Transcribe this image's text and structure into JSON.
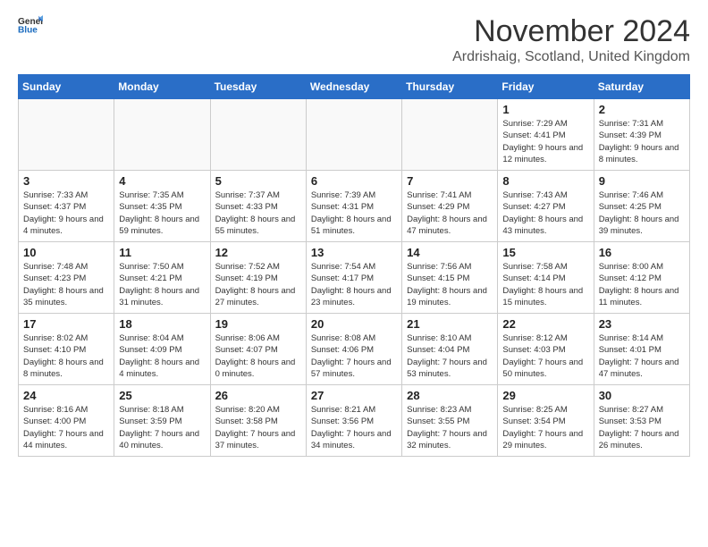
{
  "header": {
    "logo_general": "General",
    "logo_blue": "Blue",
    "month_title": "November 2024",
    "location": "Ardrishaig, Scotland, United Kingdom"
  },
  "weekdays": [
    "Sunday",
    "Monday",
    "Tuesday",
    "Wednesday",
    "Thursday",
    "Friday",
    "Saturday"
  ],
  "weeks": [
    [
      {
        "day": "",
        "info": "",
        "empty": true
      },
      {
        "day": "",
        "info": "",
        "empty": true
      },
      {
        "day": "",
        "info": "",
        "empty": true
      },
      {
        "day": "",
        "info": "",
        "empty": true
      },
      {
        "day": "",
        "info": "",
        "empty": true
      },
      {
        "day": "1",
        "info": "Sunrise: 7:29 AM\nSunset: 4:41 PM\nDaylight: 9 hours and 12 minutes."
      },
      {
        "day": "2",
        "info": "Sunrise: 7:31 AM\nSunset: 4:39 PM\nDaylight: 9 hours and 8 minutes."
      }
    ],
    [
      {
        "day": "3",
        "info": "Sunrise: 7:33 AM\nSunset: 4:37 PM\nDaylight: 9 hours and 4 minutes."
      },
      {
        "day": "4",
        "info": "Sunrise: 7:35 AM\nSunset: 4:35 PM\nDaylight: 8 hours and 59 minutes."
      },
      {
        "day": "5",
        "info": "Sunrise: 7:37 AM\nSunset: 4:33 PM\nDaylight: 8 hours and 55 minutes."
      },
      {
        "day": "6",
        "info": "Sunrise: 7:39 AM\nSunset: 4:31 PM\nDaylight: 8 hours and 51 minutes."
      },
      {
        "day": "7",
        "info": "Sunrise: 7:41 AM\nSunset: 4:29 PM\nDaylight: 8 hours and 47 minutes."
      },
      {
        "day": "8",
        "info": "Sunrise: 7:43 AM\nSunset: 4:27 PM\nDaylight: 8 hours and 43 minutes."
      },
      {
        "day": "9",
        "info": "Sunrise: 7:46 AM\nSunset: 4:25 PM\nDaylight: 8 hours and 39 minutes."
      }
    ],
    [
      {
        "day": "10",
        "info": "Sunrise: 7:48 AM\nSunset: 4:23 PM\nDaylight: 8 hours and 35 minutes."
      },
      {
        "day": "11",
        "info": "Sunrise: 7:50 AM\nSunset: 4:21 PM\nDaylight: 8 hours and 31 minutes."
      },
      {
        "day": "12",
        "info": "Sunrise: 7:52 AM\nSunset: 4:19 PM\nDaylight: 8 hours and 27 minutes."
      },
      {
        "day": "13",
        "info": "Sunrise: 7:54 AM\nSunset: 4:17 PM\nDaylight: 8 hours and 23 minutes."
      },
      {
        "day": "14",
        "info": "Sunrise: 7:56 AM\nSunset: 4:15 PM\nDaylight: 8 hours and 19 minutes."
      },
      {
        "day": "15",
        "info": "Sunrise: 7:58 AM\nSunset: 4:14 PM\nDaylight: 8 hours and 15 minutes."
      },
      {
        "day": "16",
        "info": "Sunrise: 8:00 AM\nSunset: 4:12 PM\nDaylight: 8 hours and 11 minutes."
      }
    ],
    [
      {
        "day": "17",
        "info": "Sunrise: 8:02 AM\nSunset: 4:10 PM\nDaylight: 8 hours and 8 minutes."
      },
      {
        "day": "18",
        "info": "Sunrise: 8:04 AM\nSunset: 4:09 PM\nDaylight: 8 hours and 4 minutes."
      },
      {
        "day": "19",
        "info": "Sunrise: 8:06 AM\nSunset: 4:07 PM\nDaylight: 8 hours and 0 minutes."
      },
      {
        "day": "20",
        "info": "Sunrise: 8:08 AM\nSunset: 4:06 PM\nDaylight: 7 hours and 57 minutes."
      },
      {
        "day": "21",
        "info": "Sunrise: 8:10 AM\nSunset: 4:04 PM\nDaylight: 7 hours and 53 minutes."
      },
      {
        "day": "22",
        "info": "Sunrise: 8:12 AM\nSunset: 4:03 PM\nDaylight: 7 hours and 50 minutes."
      },
      {
        "day": "23",
        "info": "Sunrise: 8:14 AM\nSunset: 4:01 PM\nDaylight: 7 hours and 47 minutes."
      }
    ],
    [
      {
        "day": "24",
        "info": "Sunrise: 8:16 AM\nSunset: 4:00 PM\nDaylight: 7 hours and 44 minutes."
      },
      {
        "day": "25",
        "info": "Sunrise: 8:18 AM\nSunset: 3:59 PM\nDaylight: 7 hours and 40 minutes."
      },
      {
        "day": "26",
        "info": "Sunrise: 8:20 AM\nSunset: 3:58 PM\nDaylight: 7 hours and 37 minutes."
      },
      {
        "day": "27",
        "info": "Sunrise: 8:21 AM\nSunset: 3:56 PM\nDaylight: 7 hours and 34 minutes."
      },
      {
        "day": "28",
        "info": "Sunrise: 8:23 AM\nSunset: 3:55 PM\nDaylight: 7 hours and 32 minutes."
      },
      {
        "day": "29",
        "info": "Sunrise: 8:25 AM\nSunset: 3:54 PM\nDaylight: 7 hours and 29 minutes."
      },
      {
        "day": "30",
        "info": "Sunrise: 8:27 AM\nSunset: 3:53 PM\nDaylight: 7 hours and 26 minutes."
      }
    ]
  ]
}
